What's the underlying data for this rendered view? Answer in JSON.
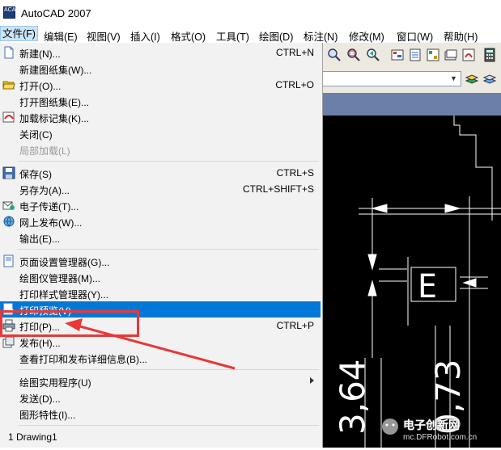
{
  "window": {
    "title": "AutoCAD 2007",
    "icon_text": "ACAD"
  },
  "menubar": [
    {
      "label": "文件(F)"
    },
    {
      "label": "编辑(E)"
    },
    {
      "label": "视图(V)"
    },
    {
      "label": "插入(I)"
    },
    {
      "label": "格式(O)"
    },
    {
      "label": "工具(T)"
    },
    {
      "label": "绘图(D)"
    },
    {
      "label": "标注(N)"
    },
    {
      "label": "修改(M)"
    },
    {
      "label": "窗口(W)"
    },
    {
      "label": "帮助(H)"
    }
  ],
  "file_menu": {
    "items": [
      {
        "label": "新建(N)...",
        "shortcut": "CTRL+N",
        "icon": "new-file-icon"
      },
      {
        "label": "新建图纸集(W)...",
        "shortcut": ""
      },
      {
        "label": "打开(O)...",
        "shortcut": "CTRL+O",
        "icon": "open-folder-icon"
      },
      {
        "label": "打开图纸集(E)...",
        "shortcut": ""
      },
      {
        "label": "加载标记集(K)...",
        "shortcut": "",
        "icon": "markup-icon"
      },
      {
        "label": "关闭(C)",
        "shortcut": ""
      },
      {
        "label": "局部加载(L)",
        "shortcut": "",
        "disabled": true
      },
      {
        "label": "保存(S)",
        "shortcut": "CTRL+S",
        "icon": "save-icon"
      },
      {
        "label": "另存为(A)...",
        "shortcut": "CTRL+SHIFT+S"
      },
      {
        "label": "电子传递(T)...",
        "shortcut": "",
        "icon": "etransmit-icon"
      },
      {
        "label": "网上发布(W)...",
        "shortcut": "",
        "icon": "publish-web-icon"
      },
      {
        "label": "输出(E)...",
        "shortcut": ""
      },
      {
        "label": "页面设置管理器(G)...",
        "shortcut": "",
        "icon": "page-setup-icon"
      },
      {
        "label": "绘图仪管理器(M)...",
        "shortcut": ""
      },
      {
        "label": "打印样式管理器(Y)...",
        "shortcut": ""
      },
      {
        "label": "打印预览(V)",
        "shortcut": "",
        "icon": "preview-icon",
        "highlighted": true
      },
      {
        "label": "打印(P)...",
        "shortcut": "CTRL+P",
        "icon": "printer-icon"
      },
      {
        "label": "发布(H)...",
        "shortcut": "",
        "icon": "publish-icon"
      },
      {
        "label": "查看打印和发布详细信息(B)...",
        "shortcut": ""
      },
      {
        "label": "绘图实用程序(U)",
        "shortcut": "",
        "submenu": true
      },
      {
        "label": "发送(D)...",
        "shortcut": ""
      },
      {
        "label": "图形特性(I)...",
        "shortcut": ""
      },
      {
        "label": "1 Drawing1",
        "shortcut": ""
      }
    ]
  },
  "drawing": {
    "dimension_1": "3,64",
    "dimension_2": "0,73",
    "datum_label": "E"
  },
  "watermark": {
    "brand": "电子创新网",
    "site": "mc.DFRobot.com.cn"
  },
  "colors": {
    "highlight": "#0078d7",
    "annotation": "#e83838",
    "canvas": "#000000"
  }
}
